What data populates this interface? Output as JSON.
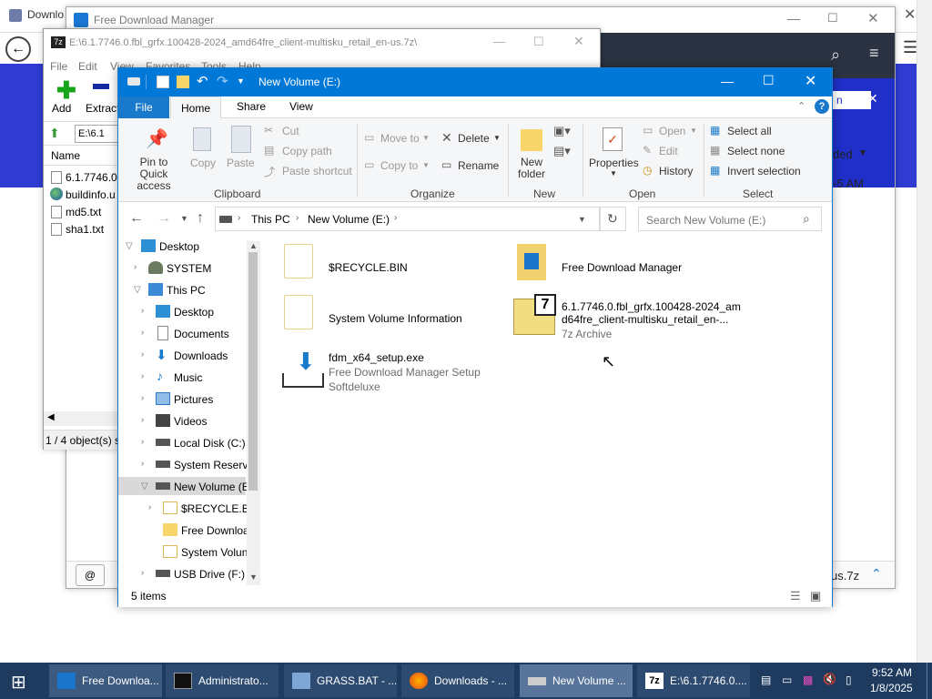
{
  "fdm": {
    "title": "Free Download Manager",
    "tab_fragment": "n",
    "filter_fragment": "ded",
    "time_fragment": "-5 AM",
    "file_fragment": "us.7z"
  },
  "browser": {
    "tab_title": "Downlo"
  },
  "sevenzip": {
    "path": "E:\\6.1.7746.0.fbl_grfx.100428-2024_amd64fre_client-multisku_retail_en-us.7z\\",
    "menu": [
      "File",
      "Edit",
      "View",
      "Favorites",
      "Tools",
      "Help"
    ],
    "tools": {
      "add": "Add",
      "extract": "Extract"
    },
    "address": "E:\\6.1",
    "column_name": "Name",
    "files": [
      "6.1.7746.0.fb",
      "buildinfo.u",
      "md5.txt",
      "sha1.txt"
    ],
    "status": "1 / 4 object(s) s"
  },
  "explorer": {
    "title": "New Volume (E:)",
    "tabs": {
      "file": "File",
      "home": "Home",
      "share": "Share",
      "view": "View"
    },
    "ribbon": {
      "pin": "Pin to Quick access",
      "copy": "Copy",
      "paste": "Paste",
      "cut": "Cut",
      "copy_path": "Copy path",
      "paste_shortcut": "Paste shortcut",
      "clipboard_group": "Clipboard",
      "move_to": "Move to",
      "copy_to": "Copy to",
      "delete": "Delete",
      "rename": "Rename",
      "organize_group": "Organize",
      "new_folder": "New folder",
      "new_group": "New",
      "properties": "Properties",
      "open": "Open",
      "edit": "Edit",
      "history": "History",
      "open_group": "Open",
      "select_all": "Select all",
      "select_none": "Select none",
      "invert_selection": "Invert selection",
      "select_group": "Select"
    },
    "breadcrumb": {
      "this_pc": "This PC",
      "volume": "New Volume (E:)"
    },
    "search_placeholder": "Search New Volume (E:)",
    "nav": [
      "Desktop",
      "SYSTEM",
      "This PC",
      "Desktop",
      "Documents",
      "Downloads",
      "Music",
      "Pictures",
      "Videos",
      "Local Disk (C:)",
      "System Reserve",
      "New Volume (E",
      "$RECYCLE.BIN",
      "Free Downloa",
      "System Volun",
      "USB Drive (F:)"
    ],
    "items": [
      {
        "name": "$RECYCLE.BIN"
      },
      {
        "name": "Free Download Manager"
      },
      {
        "name": "System Volume Information"
      },
      {
        "name_line1": "6.1.7746.0.fbl_grfx.100428-2024_am",
        "name_line2": "d64fre_client-multisku_retail_en-...",
        "sub": "7z Archive"
      },
      {
        "name": "fdm_x64_setup.exe",
        "sub1": "Free Download Manager Setup",
        "sub2": "Softdeluxe"
      }
    ],
    "status": "5 items"
  },
  "taskbar": {
    "apps": [
      "Free Downloa...",
      "Administrato...",
      "GRASS.BAT - ...",
      "Downloads - ...",
      "New Volume ...",
      "E:\\6.1.7746.0...."
    ],
    "time": "9:52 AM",
    "date": "1/8/2025"
  },
  "colors": {
    "explorer_title": "#0078d7",
    "taskbar": "#1e3a5f",
    "fdm_banner": "#2f3bd1",
    "folder": "#f0d16f"
  }
}
